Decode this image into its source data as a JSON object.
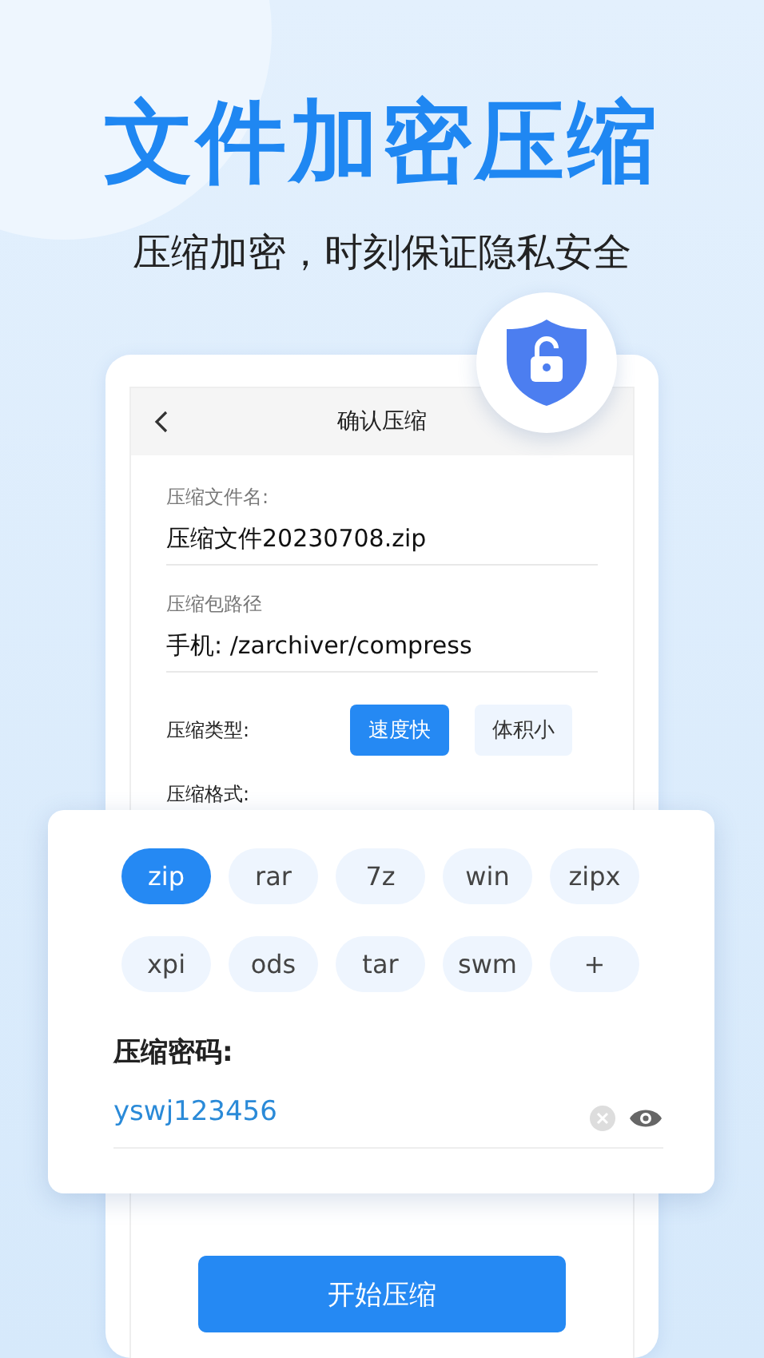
{
  "headline": "文件加密压缩",
  "subtitle": "压缩加密，时刻保证隐私安全",
  "screen": {
    "title": "确认压缩",
    "fields": [
      {
        "label": "压缩文件名:",
        "value": "压缩文件20230708.zip"
      },
      {
        "label": "压缩包路径",
        "value": "手机: /zarchiver/compress"
      }
    ],
    "compress_type": {
      "label": "压缩类型:",
      "options": [
        {
          "label": "速度快",
          "selected": true
        },
        {
          "label": "体积小",
          "selected": false
        }
      ]
    },
    "format_label": "压缩格式:",
    "start_button": "开始压缩"
  },
  "popup": {
    "formats": [
      {
        "label": "zip",
        "selected": true
      },
      {
        "label": "rar",
        "selected": false
      },
      {
        "label": "7z",
        "selected": false
      },
      {
        "label": "win",
        "selected": false
      },
      {
        "label": "zipx",
        "selected": false
      },
      {
        "label": "xpi",
        "selected": false
      },
      {
        "label": "ods",
        "selected": false
      },
      {
        "label": "tar",
        "selected": false
      },
      {
        "label": "swm",
        "selected": false
      },
      {
        "label": "+",
        "selected": false
      }
    ],
    "password_label": "压缩密码:",
    "password_value": "yswj123456"
  }
}
